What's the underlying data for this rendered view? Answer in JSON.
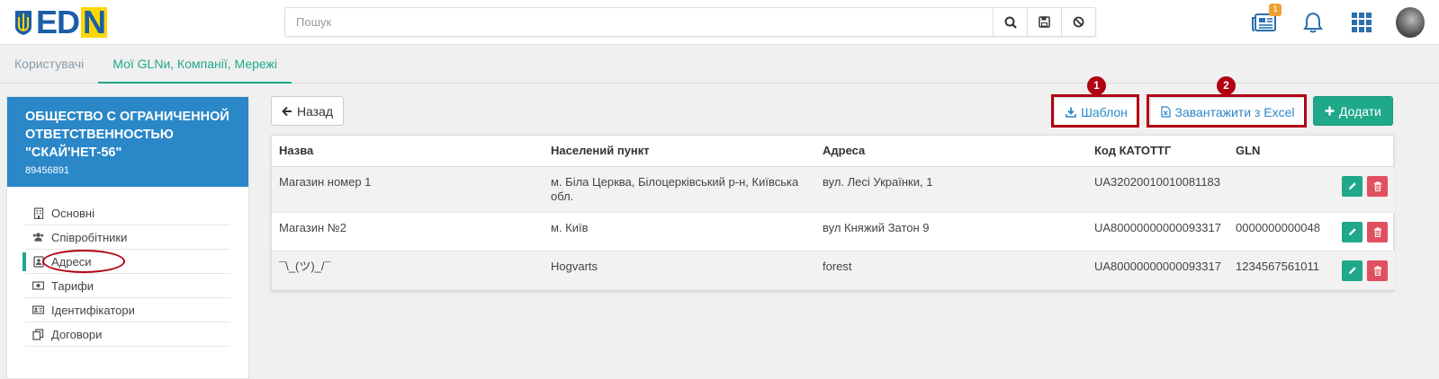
{
  "search": {
    "placeholder": "Пошук"
  },
  "tabs": [
    {
      "label": "Користувачі"
    },
    {
      "label": "Мої GLNи, Компанії, Мережі"
    }
  ],
  "notifications": {
    "news_count": "1"
  },
  "company": {
    "name": "ОБЩЕСТВО С ОГРАНИЧЕННОЙ ОТВЕТСТВЕННОСТЬЮ \"СКАЙ'НЕТ-56\"",
    "code": "89456891"
  },
  "sidebar": {
    "items": [
      {
        "label": "Основні",
        "icon": "building-icon"
      },
      {
        "label": "Співробітники",
        "icon": "users-icon"
      },
      {
        "label": "Адреси",
        "icon": "address-card-icon"
      },
      {
        "label": "Тарифи",
        "icon": "money-icon"
      },
      {
        "label": "Ідентифікатори",
        "icon": "id-card-icon"
      },
      {
        "label": "Договори",
        "icon": "copy-icon"
      }
    ]
  },
  "toolbar": {
    "back_label": "Назад",
    "template_label": "Шаблон",
    "excel_label": "Завантажити з Excel",
    "add_label": "Додати"
  },
  "annotations": {
    "n1": "1",
    "n2": "2"
  },
  "table": {
    "headers": [
      "Назва",
      "Населений пункт",
      "Адреса",
      "Код КАТОТТГ",
      "GLN"
    ],
    "rows": [
      {
        "name": "Магазин номер 1",
        "city": "м. Біла Церква, Білоцерківський р-н, Київська обл.",
        "address": "вул. Лесі Українки, 1",
        "code": "UA32020010010081183",
        "gln": ""
      },
      {
        "name": "Магазин №2",
        "city": "м. Київ",
        "address": "вул Княжий Затон 9",
        "code": "UA80000000000093317",
        "gln": "0000000000048"
      },
      {
        "name": "¯\\_(ツ)_/¯",
        "city": "Hogvarts",
        "address": "forest",
        "code": "UA80000000000093317",
        "gln": "1234567561011"
      }
    ]
  },
  "colors": {
    "accent": "#1fa88a",
    "brand_blue": "#2a87c8",
    "danger": "#e05060",
    "annotation": "#b00012"
  }
}
